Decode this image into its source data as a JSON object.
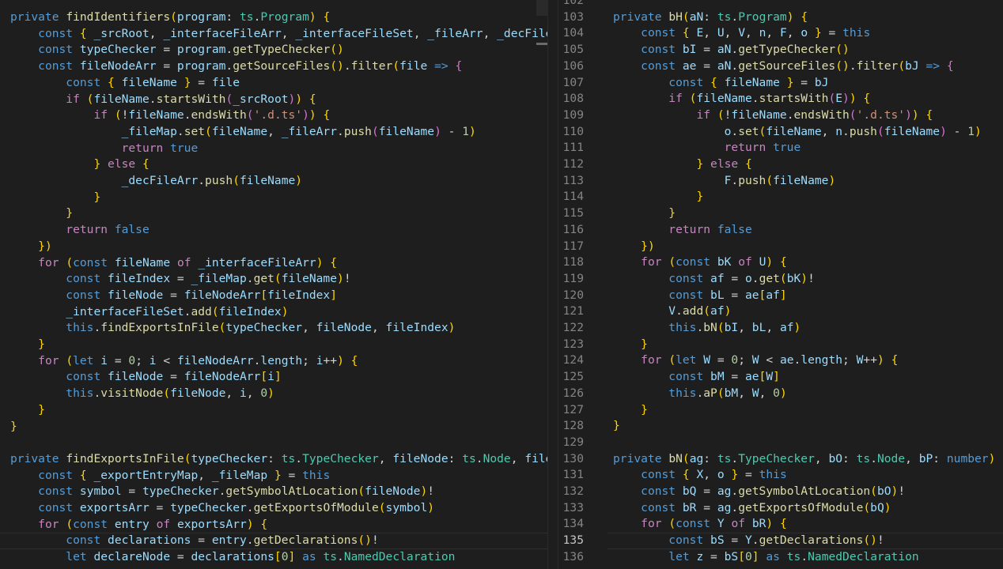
{
  "editor": {
    "theme_colors": {
      "background": "#1e1e1e",
      "keyword": "#569cd6",
      "control": "#c586c0",
      "function": "#dcdcaa",
      "type": "#4ec9b0",
      "variable": "#9cdcfe",
      "string": "#ce9178",
      "number": "#b5cea8"
    },
    "left_lines": [
      "private findIdentifiers(program: ts.Program) {",
      "    const { _srcRoot, _interfaceFileArr, _interfaceFileSet, _fileArr, _decFileArr,",
      "    const typeChecker = program.getTypeChecker()",
      "    const fileNodeArr = program.getSourceFiles().filter(file => {",
      "        const { fileName } = file",
      "        if (fileName.startsWith(_srcRoot)) {",
      "            if (!fileName.endsWith('.d.ts')) {",
      "                _fileMap.set(fileName, _fileArr.push(fileName) - 1)",
      "                return true",
      "            } else {",
      "                _decFileArr.push(fileName)",
      "            }",
      "        }",
      "        return false",
      "    })",
      "    for (const fileName of _interfaceFileArr) {",
      "        const fileIndex = _fileMap.get(fileName)!",
      "        const fileNode = fileNodeArr[fileIndex]",
      "        _interfaceFileSet.add(fileIndex)",
      "        this.findExportsInFile(typeChecker, fileNode, fileIndex)",
      "    }",
      "    for (let i = 0; i < fileNodeArr.length; i++) {",
      "        const fileNode = fileNodeArr[i]",
      "        this.visitNode(fileNode, i, 0)",
      "    }",
      "}",
      "",
      "private findExportsInFile(typeChecker: ts.TypeChecker, fileNode: ts.Node, fileInde",
      "    const { _exportEntryMap, _fileMap } = this",
      "    const symbol = typeChecker.getSymbolAtLocation(fileNode)!",
      "    const exportsArr = typeChecker.getExportsOfModule(symbol)",
      "    for (const entry of exportsArr) {",
      "        const declarations = entry.getDeclarations()!",
      "        let declareNode = declarations[0] as ts.NamedDeclaration"
    ],
    "right_lines": [
      {
        "n": "102",
        "t": ""
      },
      {
        "n": "103",
        "t": "private bH(aN: ts.Program) {"
      },
      {
        "n": "104",
        "t": "    const { E, U, V, n, F, o } = this"
      },
      {
        "n": "105",
        "t": "    const bI = aN.getTypeChecker()"
      },
      {
        "n": "106",
        "t": "    const ae = aN.getSourceFiles().filter(bJ => {"
      },
      {
        "n": "107",
        "t": "        const { fileName } = bJ"
      },
      {
        "n": "108",
        "t": "        if (fileName.startsWith(E)) {"
      },
      {
        "n": "109",
        "t": "            if (!fileName.endsWith('.d.ts')) {"
      },
      {
        "n": "110",
        "t": "                o.set(fileName, n.push(fileName) - 1)"
      },
      {
        "n": "111",
        "t": "                return true"
      },
      {
        "n": "112",
        "t": "            } else {"
      },
      {
        "n": "113",
        "t": "                F.push(fileName)"
      },
      {
        "n": "114",
        "t": "            }"
      },
      {
        "n": "115",
        "t": "        }"
      },
      {
        "n": "116",
        "t": "        return false"
      },
      {
        "n": "117",
        "t": "    })"
      },
      {
        "n": "118",
        "t": "    for (const bK of U) {"
      },
      {
        "n": "119",
        "t": "        const af = o.get(bK)!"
      },
      {
        "n": "120",
        "t": "        const bL = ae[af]"
      },
      {
        "n": "121",
        "t": "        V.add(af)"
      },
      {
        "n": "122",
        "t": "        this.bN(bI, bL, af)"
      },
      {
        "n": "123",
        "t": "    }"
      },
      {
        "n": "124",
        "t": "    for (let W = 0; W < ae.length; W++) {"
      },
      {
        "n": "125",
        "t": "        const bM = ae[W]"
      },
      {
        "n": "126",
        "t": "        this.aP(bM, W, 0)"
      },
      {
        "n": "127",
        "t": "    }"
      },
      {
        "n": "128",
        "t": "}"
      },
      {
        "n": "129",
        "t": ""
      },
      {
        "n": "130",
        "t": "private bN(ag: ts.TypeChecker, bO: ts.Node, bP: number) {"
      },
      {
        "n": "131",
        "t": "    const { X, o } = this"
      },
      {
        "n": "132",
        "t": "    const bQ = ag.getSymbolAtLocation(bO)!"
      },
      {
        "n": "133",
        "t": "    const bR = ag.getExportsOfModule(bQ)"
      },
      {
        "n": "134",
        "t": "    for (const Y of bR) {"
      },
      {
        "n": "135",
        "t": "        const bS = Y.getDeclarations()!"
      },
      {
        "n": "136",
        "t": "        let z = bS[0] as ts.NamedDeclaration"
      }
    ],
    "active_line": "135"
  }
}
